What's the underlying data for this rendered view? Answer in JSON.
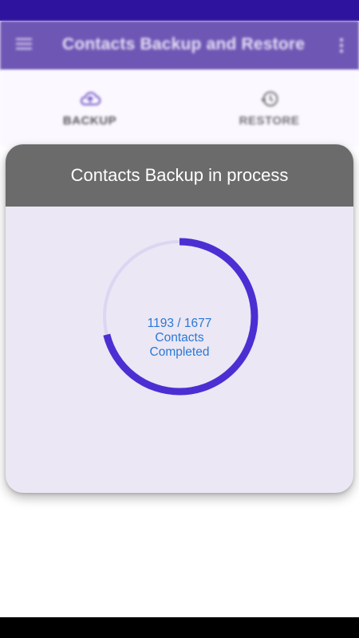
{
  "app_bar": {
    "title": "Contacts Backup and Restore",
    "menu_icon": "hamburger-menu-icon",
    "overflow_icon": "more-vert-icon",
    "background": "#6e56b4"
  },
  "status_bar": {
    "background": "#2e139e"
  },
  "tabs": [
    {
      "label": "BACKUP",
      "icon": "cloud-upload-icon",
      "selected": true
    },
    {
      "label": "RESTORE",
      "icon": "history-icon",
      "selected": false
    }
  ],
  "dialog": {
    "title": "Contacts Backup in process",
    "header_color": "#6b6b6b",
    "progress": {
      "completed": 1193,
      "total": 1677,
      "fraction": 0.711,
      "line1": "1193 / 1677",
      "line2": "Contacts",
      "line3": "Completed",
      "ring_color": "#4c2fd3",
      "track_color": "#dcd6f2",
      "text_color": "#2a78d6"
    }
  }
}
